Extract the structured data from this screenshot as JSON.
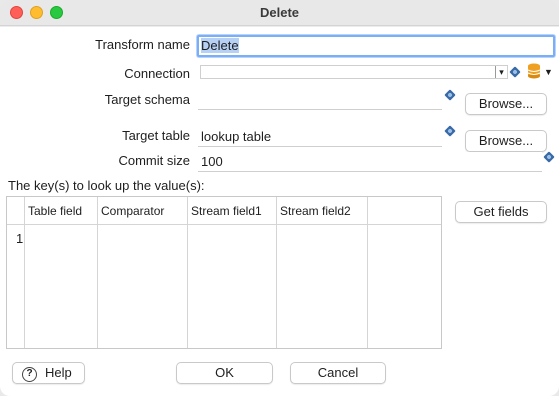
{
  "window": {
    "title": "Delete"
  },
  "form": {
    "transform_name": {
      "label": "Transform name",
      "value": "Delete"
    },
    "connection": {
      "label": "Connection",
      "value": ""
    },
    "target_schema": {
      "label": "Target schema",
      "value": "",
      "browse_label": "Browse..."
    },
    "target_table": {
      "label": "Target table",
      "value": "lookup table",
      "browse_label": "Browse..."
    },
    "commit_size": {
      "label": "Commit size",
      "value": "100"
    }
  },
  "keys": {
    "label": "The key(s) to look up the value(s):",
    "get_fields_label": "Get fields",
    "columns": [
      "Table field",
      "Comparator",
      "Stream field1",
      "Stream field2"
    ],
    "rows": [
      {
        "num": "1",
        "cells": [
          "",
          "",
          "",
          ""
        ]
      }
    ]
  },
  "footer": {
    "help_label": "Help",
    "ok_label": "OK",
    "cancel_label": "Cancel"
  },
  "colors": {
    "close": "#ff5f57",
    "minimize": "#febc2e",
    "maximize": "#28c840",
    "focus": "#7aaef5",
    "db_icon": "#f0a020"
  }
}
